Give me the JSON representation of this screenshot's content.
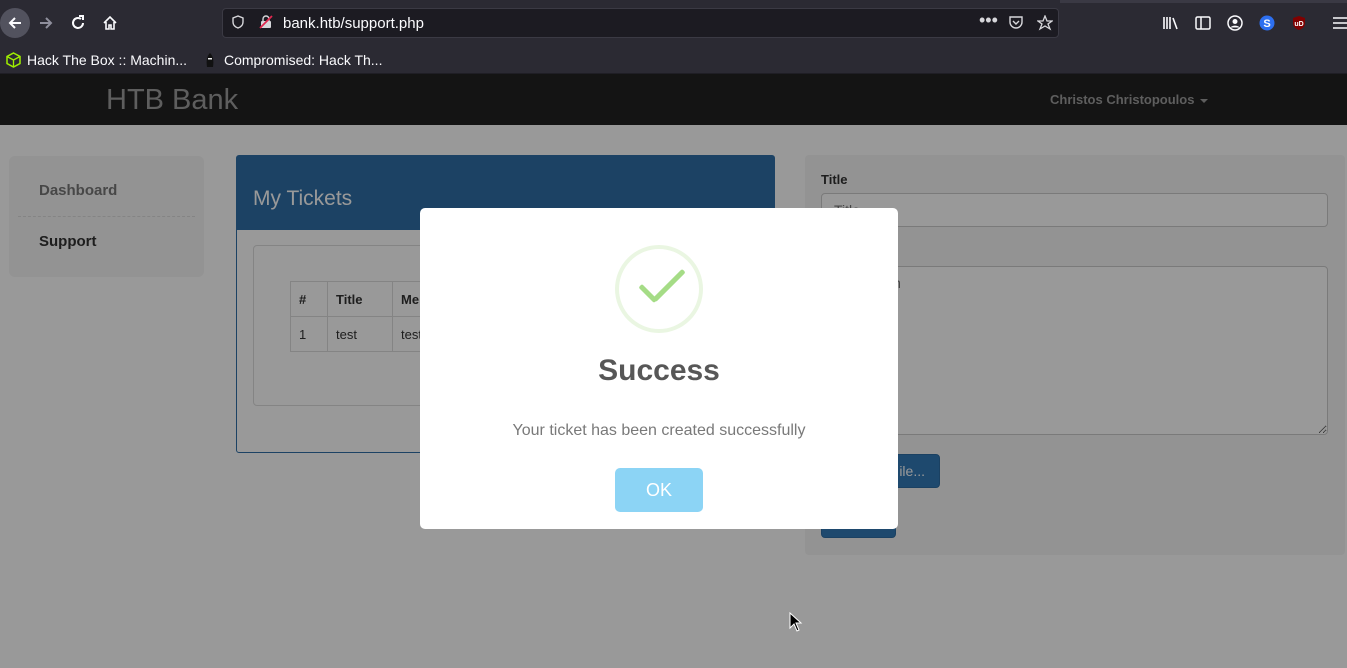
{
  "browser": {
    "url": "bank.htb/support.php",
    "bookmarks": [
      {
        "label": "Hack The Box :: Machin...",
        "icon": "hackthebox-cube-icon"
      },
      {
        "label": "Compromised: Hack Th...",
        "icon": "ninja-icon"
      }
    ],
    "colors": {
      "chrome": "#2b2a33",
      "url_bar": "#1c1b22"
    }
  },
  "page": {
    "brand": "HTB Bank",
    "user_menu": "Christos Christopoulos",
    "sidebar": {
      "items": [
        {
          "label": "Dashboard"
        },
        {
          "label": "Support"
        }
      ]
    },
    "tickets": {
      "heading": "My Tickets",
      "columns": [
        "#",
        "Title",
        "Me"
      ],
      "rows": [
        [
          "1",
          "test",
          "test"
        ]
      ]
    },
    "form": {
      "title_label": "Title",
      "title_placeholder": "Title",
      "message_placeholder": "ur problem",
      "file_button": "ile..."
    },
    "colors": {
      "navbar": "#222222",
      "panel_primary": "#337ab7"
    }
  },
  "modal": {
    "title": "Success",
    "message": "Your ticket has been created successfully",
    "ok_label": "OK",
    "icon": "success-check-icon",
    "colors": {
      "check": "#a5dc86",
      "ok_button": "#8cd4f5"
    }
  }
}
